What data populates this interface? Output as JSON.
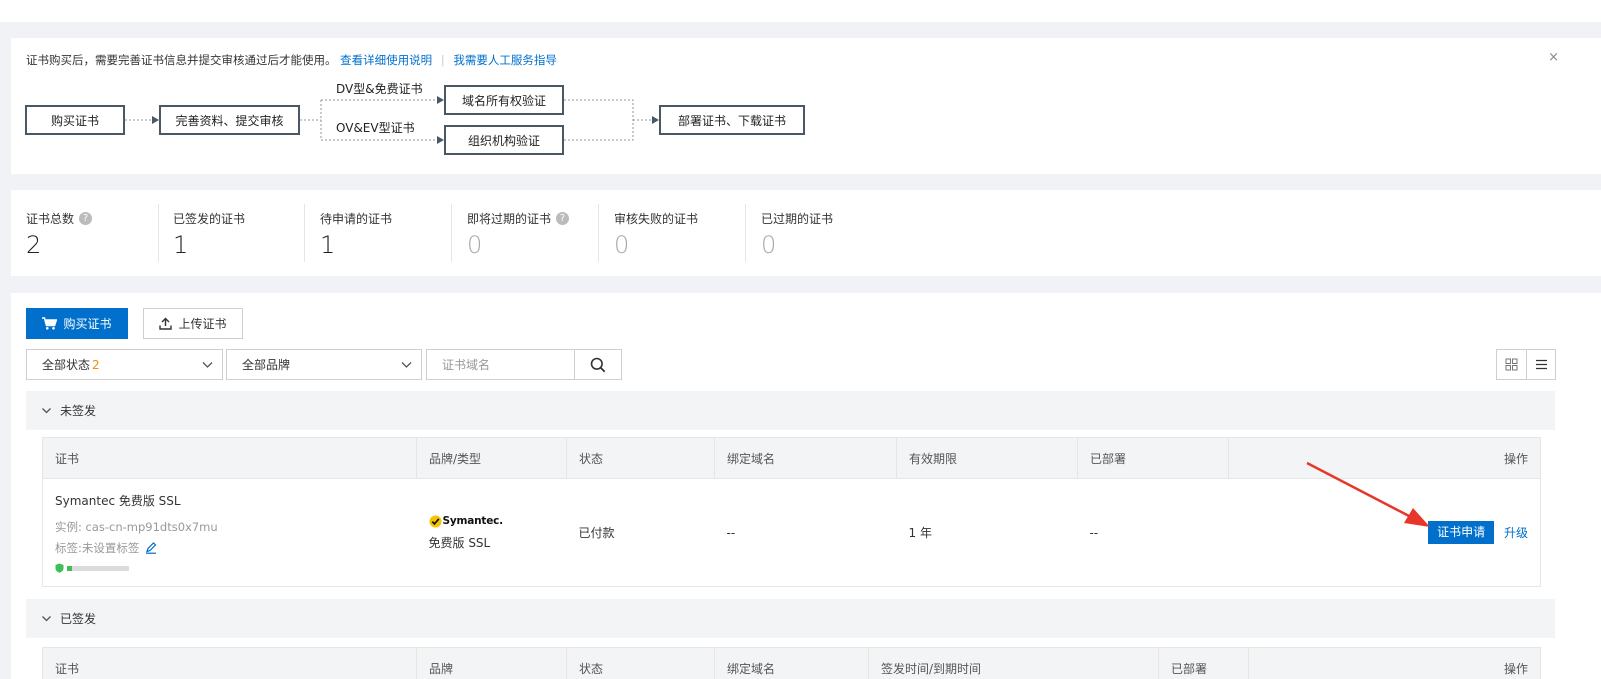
{
  "notice": {
    "text": "证书购买后，需要完善证书信息并提交审核通过后才能使用。",
    "link_usage": "查看详细使用说明",
    "separator": "|",
    "link_help": "我需要人工服务指导",
    "close": "×"
  },
  "flow": {
    "step_buy": "购买证书",
    "step_complete": "完善资料、提交审核",
    "branch_dv": "DV型&免费证书",
    "branch_ov": "OV&EV型证书",
    "step_domain_verify": "域名所有权验证",
    "step_org_verify": "组织机构验证",
    "step_deploy": "部署证书、下载证书"
  },
  "stats": [
    {
      "label": "证书总数",
      "value": "2",
      "help": true,
      "muted": false
    },
    {
      "label": "已签发的证书",
      "value": "1",
      "help": false,
      "muted": false
    },
    {
      "label": "待申请的证书",
      "value": "1",
      "help": false,
      "muted": false
    },
    {
      "label": "即将过期的证书",
      "value": "0",
      "help": true,
      "muted": true
    },
    {
      "label": "审核失败的证书",
      "value": "0",
      "help": false,
      "muted": true
    },
    {
      "label": "已过期的证书",
      "value": "0",
      "help": false,
      "muted": true
    }
  ],
  "toolbar": {
    "buy_label": "购买证书",
    "upload_label": "上传证书"
  },
  "filters": {
    "status_label": "全部状态",
    "status_count": "2",
    "brand_label": "全部品牌",
    "search_placeholder": "证书域名"
  },
  "groups": {
    "unsigned_label": "未签发",
    "signed_label": "已签发"
  },
  "table_unsigned": {
    "headers": [
      "证书",
      "品牌/类型",
      "状态",
      "绑定域名",
      "有效期限",
      "已部署",
      "操作"
    ],
    "row": {
      "name": "Symantec 免费版 SSL",
      "instance": "实例: cas-cn-mp91dts0x7mu",
      "tags": "标签:未设置标签",
      "brand": "Symantec.",
      "type": "免费版 SSL",
      "status": "已付款",
      "domain": "--",
      "validity": "1 年",
      "deployed": "--",
      "action_apply": "证书申请",
      "action_upgrade": "升级"
    }
  },
  "table_signed": {
    "headers": [
      "证书",
      "品牌",
      "状态",
      "绑定域名",
      "签发时间/到期时间",
      "已部署",
      "操作"
    ]
  },
  "colors": {
    "primary": "#0070cc",
    "annotation_arrow": "#e8362b",
    "count_badge": "#f29000"
  }
}
